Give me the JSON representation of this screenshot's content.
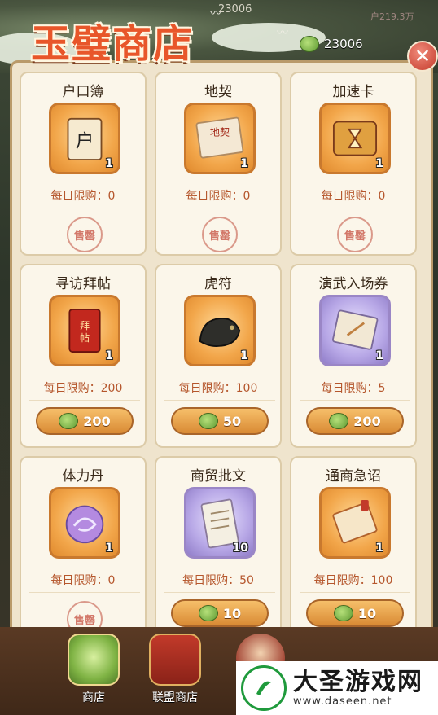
{
  "header": {
    "title": "玉璧商店",
    "background_currency": "23006",
    "background_currency_2": "户219.3万",
    "currency_icon": "jade-coin-icon",
    "currency_value": "23006",
    "close_icon": "close-icon",
    "close_label": "✕"
  },
  "cards": [
    {
      "name": "户口簿",
      "limit": "每日限购：0",
      "count": "1",
      "sold": "售罄",
      "price": null,
      "art": "booklet-icon",
      "frame": "orange"
    },
    {
      "name": "地契",
      "limit": "每日限购：0",
      "count": "1",
      "sold": "售罄",
      "price": null,
      "art": "deed-scroll-icon",
      "frame": "orange"
    },
    {
      "name": "加速卡",
      "limit": "每日限购：0",
      "count": "1",
      "sold": "售罄",
      "price": null,
      "art": "hourglass-card-icon",
      "frame": "orange"
    },
    {
      "name": "寻访拜帖",
      "limit": "每日限购：200",
      "count": "1",
      "sold": null,
      "price": "200",
      "art": "invitation-book-icon",
      "frame": "orange"
    },
    {
      "name": "虎符",
      "limit": "每日限购：100",
      "count": "1",
      "sold": null,
      "price": "50",
      "art": "tiger-tally-icon",
      "frame": "orange"
    },
    {
      "name": "演武入场券",
      "limit": "每日限购：5",
      "count": "1",
      "sold": null,
      "price": "200",
      "art": "ticket-icon",
      "frame": "purple"
    },
    {
      "name": "体力丹",
      "limit": "每日限购：0",
      "count": "1",
      "sold": "售罄",
      "price": null,
      "art": "stamina-pill-icon",
      "frame": "orange"
    },
    {
      "name": "商贸批文",
      "limit": "每日限购：50",
      "count": "10",
      "sold": null,
      "price": "10",
      "art": "trade-scroll-icon",
      "frame": "purple"
    },
    {
      "name": "通商急诏",
      "limit": "每日限购：100",
      "count": "1",
      "sold": null,
      "price": "10",
      "art": "edict-scroll-icon",
      "frame": "orange"
    }
  ],
  "tabs": [
    {
      "label": "商店",
      "icon": "jade-dragon-icon"
    },
    {
      "label": "联盟商店",
      "icon": "alliance-banner-icon"
    }
  ],
  "watermark": {
    "cn": "大圣游戏网",
    "url": "www.daseen.net"
  },
  "colors": {
    "title": "#e8562a",
    "limit_text": "#b5562c",
    "price_button": "#e9a14c",
    "panel": "#efe4cd"
  }
}
